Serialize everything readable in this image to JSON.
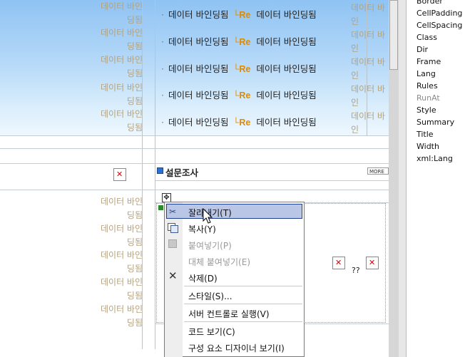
{
  "left_column": {
    "repeated_text_line1": "데이터 바인",
    "repeated_text_line2": "딩됨"
  },
  "rows": [
    {
      "text1": "데이터 바인딩됨",
      "re": "└Re",
      "text2": "데이터 바인딩됨"
    },
    {
      "text1": "데이터 바인딩됨",
      "re": "└Re",
      "text2": "데이터 바인딩됨"
    },
    {
      "text1": "데이터 바인딩됨",
      "re": "└Re",
      "text2": "데이터 바인딩됨"
    },
    {
      "text1": "데이터 바인딩됨",
      "re": "└Re",
      "text2": "데이터 바인딩됨"
    },
    {
      "text1": "데이터 바인딩됨",
      "re": "└Re",
      "text2": "데이터 바인딩됨"
    }
  ],
  "bullet": "·",
  "right_column_text": "데이터 바인",
  "section_title": "설문조사",
  "more_label": "MORE",
  "question_marks": "??",
  "properties": [
    {
      "label": "Border",
      "disabled": false
    },
    {
      "label": "CellPadding",
      "disabled": false
    },
    {
      "label": "CellSpacing",
      "disabled": false
    },
    {
      "label": "Class",
      "disabled": false
    },
    {
      "label": "Dir",
      "disabled": false
    },
    {
      "label": "Frame",
      "disabled": false
    },
    {
      "label": "Lang",
      "disabled": false
    },
    {
      "label": "Rules",
      "disabled": false
    },
    {
      "label": "RunAt",
      "disabled": true
    },
    {
      "label": "Style",
      "disabled": false
    },
    {
      "label": "Summary",
      "disabled": false
    },
    {
      "label": "Title",
      "disabled": false
    },
    {
      "label": "Width",
      "disabled": false
    },
    {
      "label": "xml:Lang",
      "disabled": false
    }
  ],
  "context_menu": {
    "items": [
      {
        "label": "잘라내기(T)",
        "icon": "scissors-icon",
        "disabled": false,
        "highlighted": true
      },
      {
        "label": "복사(Y)",
        "icon": "copy-icon",
        "disabled": false
      },
      {
        "label": "붙여넣기(P)",
        "icon": "paste-icon",
        "disabled": true
      },
      {
        "label": "대체 붙여넣기(E)",
        "icon": "",
        "disabled": true
      },
      {
        "label": "삭제(D)",
        "icon": "delete-icon",
        "disabled": false
      },
      {
        "label": "스타일(S)...",
        "icon": "",
        "disabled": false
      },
      {
        "label": "서버 컨트롤로 실행(V)",
        "icon": "",
        "disabled": false
      },
      {
        "label": "코드 보기(C)",
        "icon": "",
        "disabled": false
      },
      {
        "label": "구성 요소 디자이너 보기(I)",
        "icon": "",
        "disabled": false
      }
    ]
  },
  "colors": {
    "menu_highlight": "#b9c6e6",
    "re_accent": "#e08a00",
    "gray_text": "#b5a27c"
  }
}
